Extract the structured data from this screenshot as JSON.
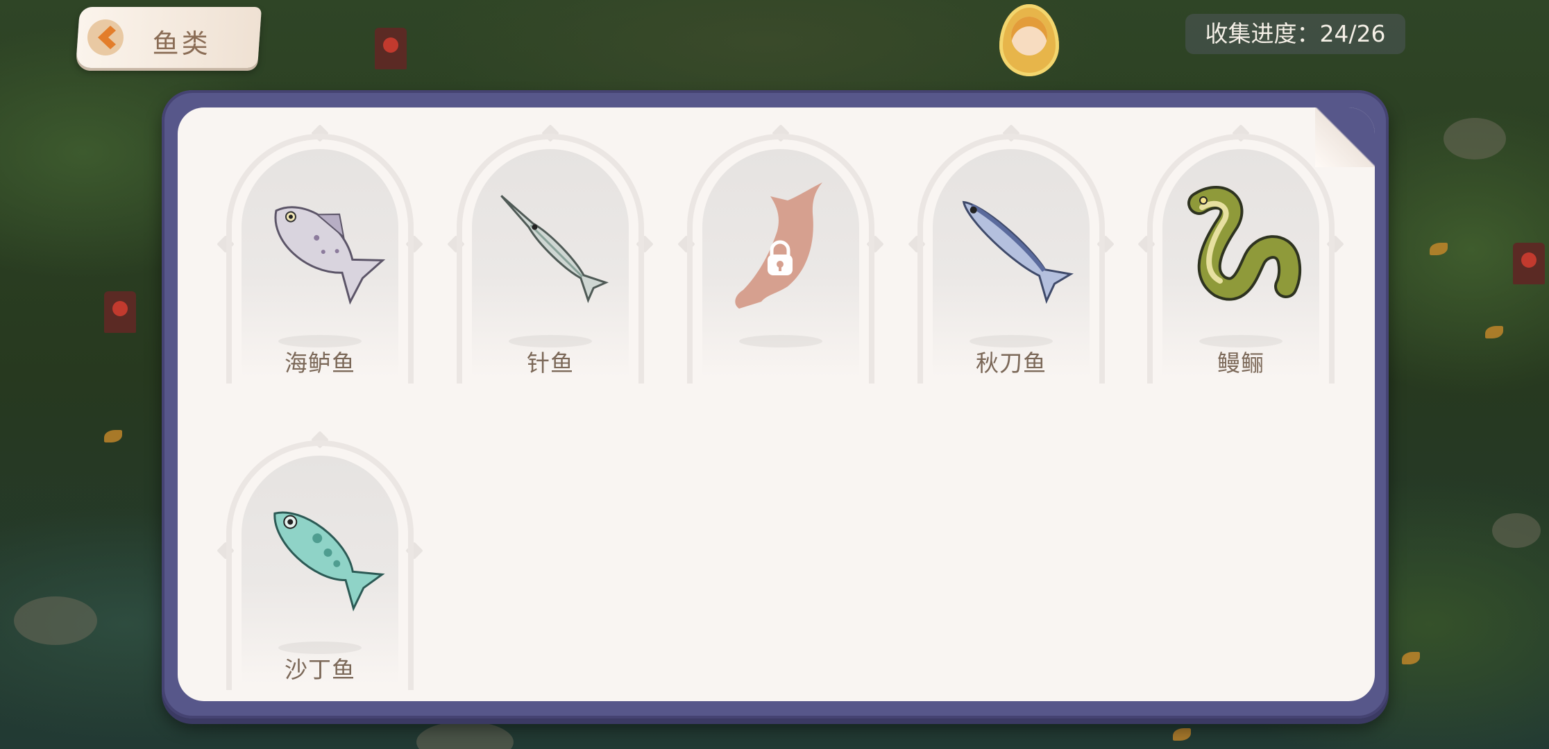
{
  "header": {
    "title": "鱼类",
    "back_icon": "chevron-left-icon"
  },
  "progress": {
    "label": "收集进度：24/26"
  },
  "colors": {
    "panel_frame": "#57578a",
    "panel_bg": "#f9f5f2",
    "card_name": "#7b6858",
    "locked_silhouette": "#d6a08f",
    "back_chevron": "#e37d2a"
  },
  "fish_cards": [
    {
      "name": "海鲈鱼",
      "icon": "sea-bass-icon",
      "locked": false
    },
    {
      "name": "针鱼",
      "icon": "needlefish-icon",
      "locked": false
    },
    {
      "name": "",
      "icon": "locked-fish-silhouette-icon",
      "locked": true
    },
    {
      "name": "秋刀鱼",
      "icon": "saury-icon",
      "locked": false
    },
    {
      "name": "鳗鲡",
      "icon": "eel-icon",
      "locked": false
    },
    {
      "name": "沙丁鱼",
      "icon": "sardine-icon",
      "locked": false
    }
  ]
}
